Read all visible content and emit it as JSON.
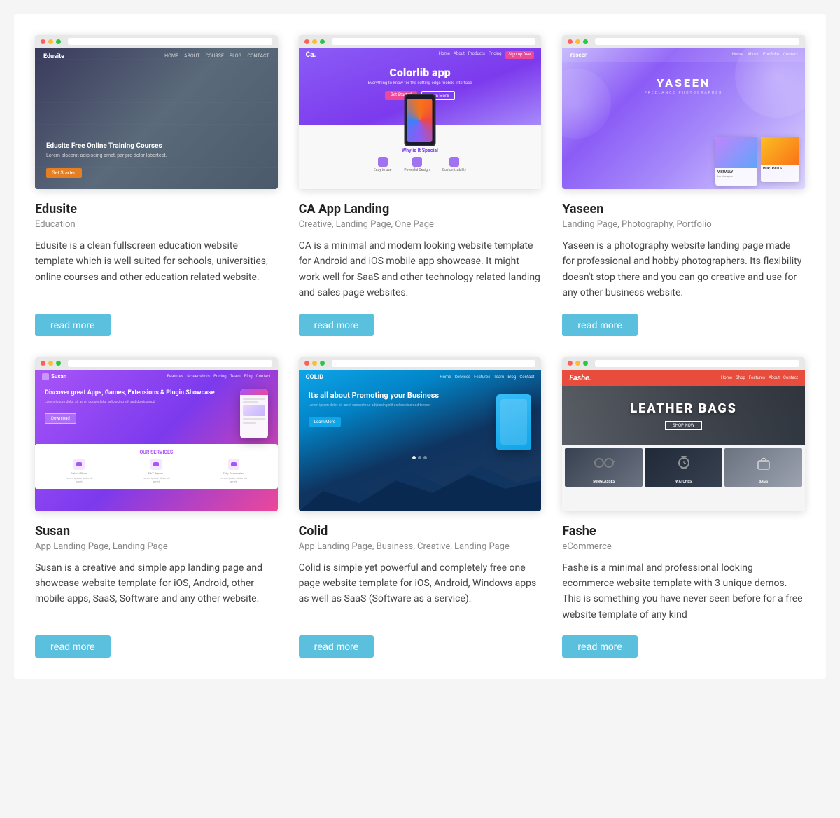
{
  "cards": [
    {
      "id": "edusite",
      "title": "Edusite",
      "tags": "Education",
      "description": "Edusite is a clean fullscreen education website template which is well suited for schools, universities, online courses and other education related website.",
      "read_more": "read more",
      "thumb_title": "Edusite Free Online Training Courses",
      "thumb_desc": "Lorem placerat adipiscing amet, per pro dolor laborteet."
    },
    {
      "id": "ca-app-landing",
      "title": "CA App Landing",
      "tags": "Creative, Landing Page, One Page",
      "description": "CA is a minimal and modern looking website template for Android and iOS mobile app showcase. It might work well for SaaS and other technology related landing and sales page websites.",
      "read_more": "read more",
      "thumb_logo": "Ca.",
      "thumb_title": "Colorlib app",
      "thumb_subtitle": "Everything to know for the cutting-edge mobile interface",
      "thumb_why": "Why is It Special",
      "thumb_features": [
        "Easy to use",
        "Powerful Design",
        "Customizability"
      ]
    },
    {
      "id": "yaseen",
      "title": "Yaseen",
      "tags": "Landing Page, Photography, Portfolio",
      "description": "Yaseen is a photography website landing page made for professional and hobby photographers. Its flexibility doesn't stop there and you can go creative and use for any other business website.",
      "read_more": "read more",
      "thumb_name": "YASEEN",
      "thumb_subtitle": "FREELANCE PHOTOGRAPHER",
      "thumb_card_label": "VISUALLY",
      "thumb_card_sub": "Landscapes"
    },
    {
      "id": "susan",
      "title": "Susan",
      "tags": "App Landing Page, Landing Page",
      "description": "Susan is a creative and simple app landing page and showcase website template for iOS, Android, other mobile apps, SaaS, Software and any other website.",
      "read_more": "read more",
      "thumb_logo": "Susan",
      "thumb_title": "Discover great Apps, Games, Extensions & Plugin Showcase",
      "thumb_services": "OUR SERVICES",
      "thumb_service_items": [
        "Data in Cloud",
        "24/7 Support",
        "Fully Responsive"
      ]
    },
    {
      "id": "colid",
      "title": "Colid",
      "tags": "App Landing Page, Business, Creative, Landing Page",
      "description": "Colid is simple yet powerful and completely free one page website template for iOS, Android, Windows apps as well as SaaS (Software as a service).",
      "read_more": "read more",
      "thumb_logo": "COLID",
      "thumb_title": "It's all about Promoting your Business"
    },
    {
      "id": "fashe",
      "title": "Fashe",
      "tags": "eCommerce",
      "description": "Fashe is a minimal and professional looking ecommerce website template with 3 unique demos. This is something you have never seen before for a free website template of any kind",
      "read_more": "read more",
      "thumb_logo": "Fashe.",
      "thumb_hero_title": "LEATHER BAGS",
      "thumb_hero_btn": "SHOP NOW",
      "thumb_products": [
        "SUNGLASSES",
        "WATCHES",
        "BAGS"
      ]
    }
  ],
  "buttons": {
    "read_more": "read more"
  }
}
